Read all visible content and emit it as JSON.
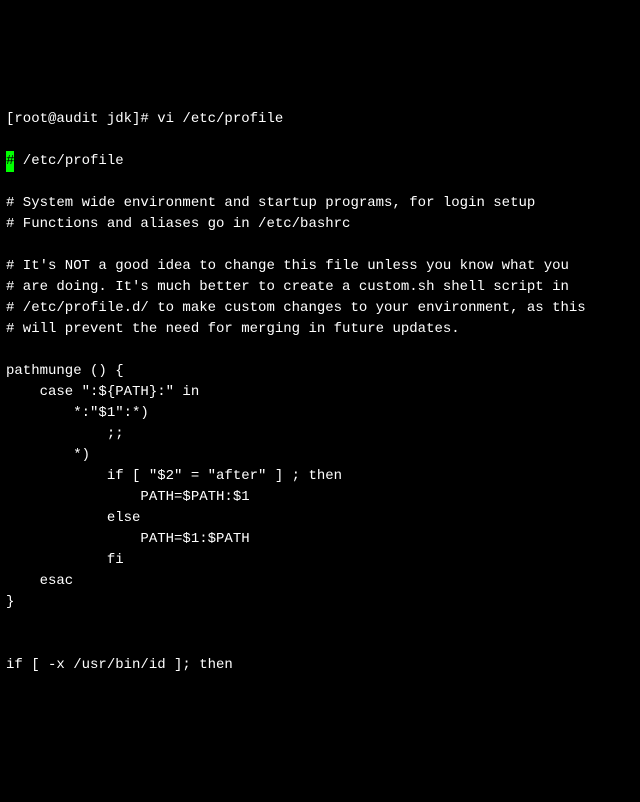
{
  "prompt": "[root@audit jdk]# vi /etc/profile",
  "cursor_char": "#",
  "file_header": " /etc/profile",
  "lines": [
    "",
    "# System wide environment and startup programs, for login setup",
    "# Functions and aliases go in /etc/bashrc",
    "",
    "# It's NOT a good idea to change this file unless you know what you",
    "# are doing. It's much better to create a custom.sh shell script in",
    "# /etc/profile.d/ to make custom changes to your environment, as this",
    "# will prevent the need for merging in future updates.",
    "",
    "pathmunge () {",
    "    case \":${PATH}:\" in",
    "        *:\"$1\":*)",
    "            ;;",
    "        *)",
    "            if [ \"$2\" = \"after\" ] ; then",
    "                PATH=$PATH:$1",
    "            else",
    "                PATH=$1:$PATH",
    "            fi",
    "    esac",
    "}",
    "",
    "",
    "if [ -x /usr/bin/id ]; then"
  ]
}
